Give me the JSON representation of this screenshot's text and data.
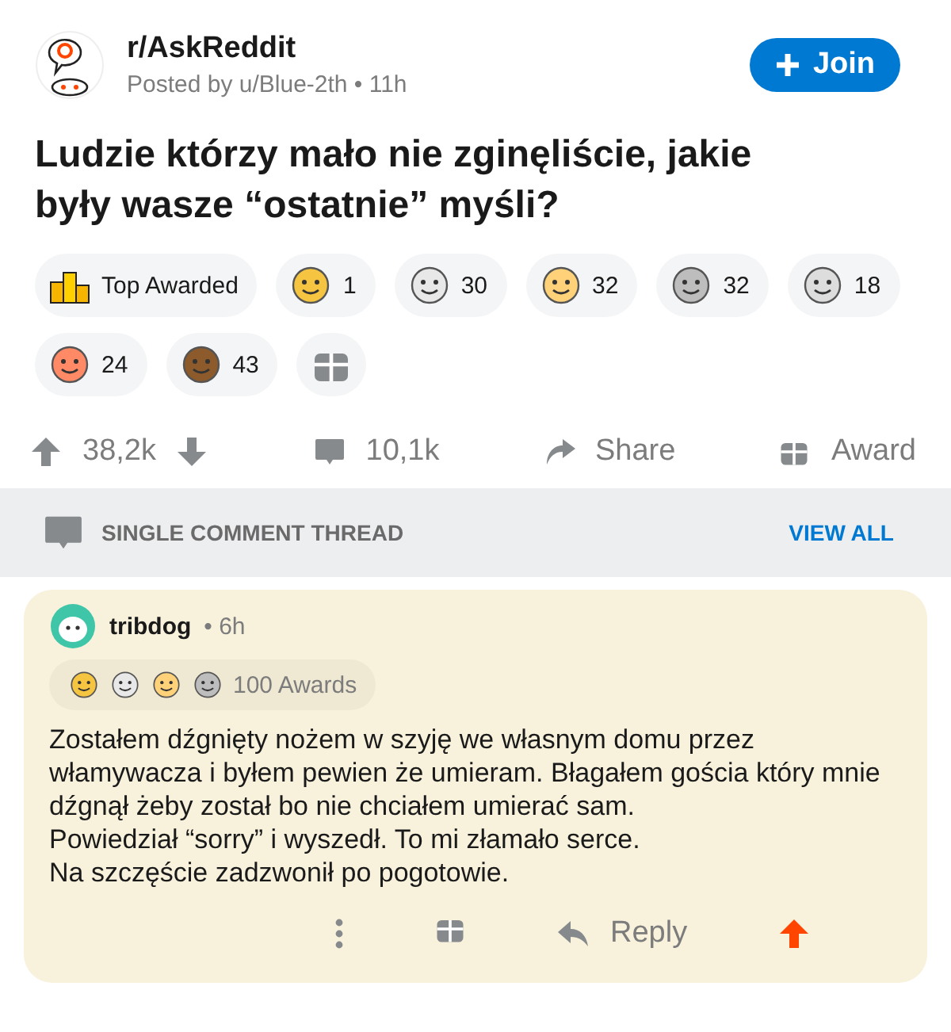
{
  "post": {
    "subreddit": "r/AskReddit",
    "meta": "Posted by u/Blue-2th • 11h",
    "join": "Join",
    "title": "Ludzie którzy mało nie zginęliście, jakie były wasze “ostatnie” myśli?",
    "awards": [
      {
        "kind": "top",
        "label": "Top Awarded"
      },
      {
        "kind": "award",
        "count": "1"
      },
      {
        "kind": "award",
        "count": "30"
      },
      {
        "kind": "award",
        "count": "32"
      },
      {
        "kind": "award",
        "count": "32"
      },
      {
        "kind": "award",
        "count": "18"
      },
      {
        "kind": "award",
        "count": "24"
      },
      {
        "kind": "award",
        "count": "43"
      },
      {
        "kind": "gift"
      }
    ],
    "votes": "38,2k",
    "comments": "10,1k",
    "share": "Share",
    "award": "Award"
  },
  "thread_bar": {
    "label": "SINGLE COMMENT THREAD",
    "link": "VIEW ALL"
  },
  "comment": {
    "author": "tribdog",
    "age": "• 6h",
    "awards_label": "100 Awards",
    "award_icons": [
      {
        "kind": "award"
      },
      {
        "kind": "award"
      },
      {
        "kind": "award"
      },
      {
        "kind": "award"
      }
    ],
    "paragraphs": [
      "Zostałem dźgnięty nożem w szyję we własnym domu przez włamywacza i byłem pewien że umieram. Błagałem gościa który mnie dźgnął żeby został bo nie chciałem umierać sam.",
      "Powiedział “sorry” i wyszedł. To mi złamało serce.",
      "Na szczęście zadzwonił po pogotowie."
    ],
    "reply": "Reply",
    "upvoted": true
  }
}
